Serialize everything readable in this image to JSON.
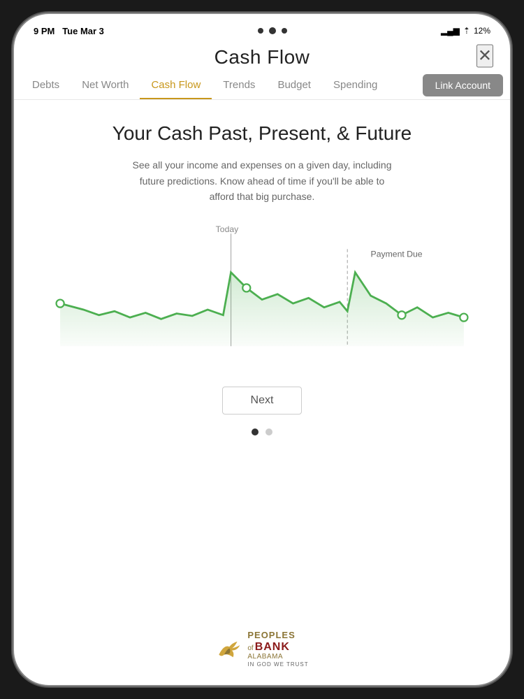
{
  "device": {
    "status_bar": {
      "time": "9 PM",
      "date": "Tue Mar 3",
      "battery": "12%",
      "battery_icon": "battery-icon",
      "wifi_icon": "wifi-icon",
      "signal_icon": "signal-icon"
    }
  },
  "header": {
    "title": "Cash Flow",
    "close_label": "✕"
  },
  "nav": {
    "tabs": [
      {
        "label": "Debts",
        "active": false
      },
      {
        "label": "Net Worth",
        "active": false
      },
      {
        "label": "Cash Flow",
        "active": true
      },
      {
        "label": "Trends",
        "active": false
      },
      {
        "label": "Budget",
        "active": false
      },
      {
        "label": "Spending",
        "active": false
      }
    ],
    "link_account_label": "Link Account"
  },
  "main": {
    "section_title": "Your Cash Past, Present, & Future",
    "section_desc": "See all your income and expenses on a given day, including future predictions. Know ahead of time if you'll be able to afford that big purchase.",
    "chart": {
      "today_label": "Today",
      "payment_due_label": "Payment Due"
    },
    "next_button_label": "Next",
    "pagination": {
      "current": 1,
      "total": 2
    }
  },
  "footer": {
    "logo_peoples": "PEOPLES",
    "logo_bank": "BANK",
    "logo_of": "of",
    "logo_alabama": "ALABAMA",
    "logo_tagline": "IN GOD WE TRUST"
  }
}
